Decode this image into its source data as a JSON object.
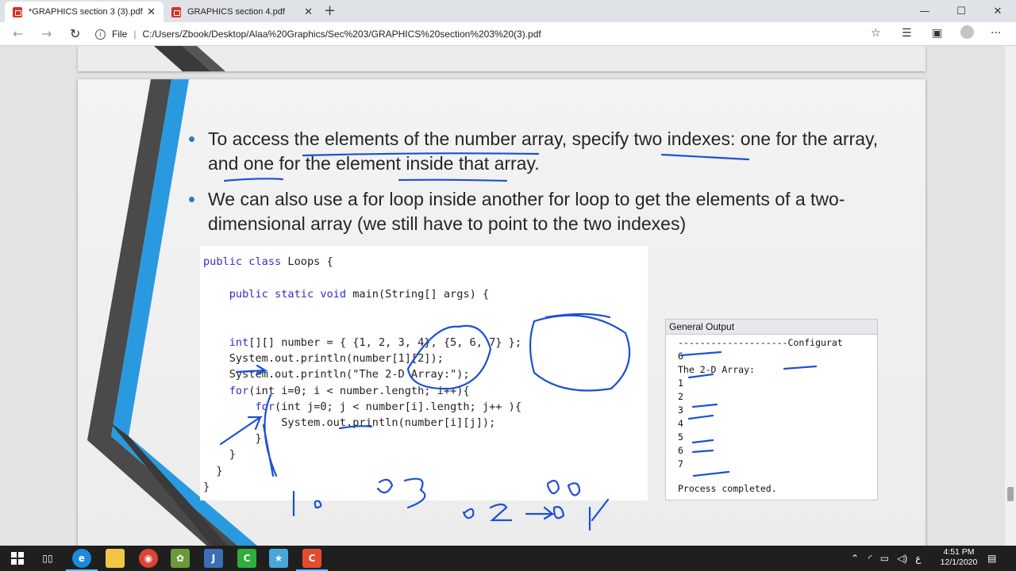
{
  "browser": {
    "tabs": [
      {
        "label": "*GRAPHICS section 3 (3).pdf",
        "active": true
      },
      {
        "label": "GRAPHICS section 4.pdf",
        "active": false
      }
    ],
    "tab_close": "✕",
    "new_tab": "+",
    "window_buttons": [
      "—",
      "☐",
      "✕"
    ],
    "address": {
      "scheme_label": "File",
      "url": "C:/Users/Zbook/Desktop/Alaa%20Graphics/Sec%203/GRAPHICS%20section%203%20(3).pdf"
    },
    "nav": {
      "back": "←",
      "forward": "→",
      "refresh": "↻"
    },
    "toolbar_icons": [
      "star-icon",
      "favorites-icon",
      "collections-icon",
      "profile-icon",
      "more-icon"
    ],
    "more": "···"
  },
  "slide": {
    "bullets": [
      "To access the elements of the number array, specify two indexes: one for the array, and one for the element inside that array.",
      "We can also use a for loop inside another for loop to get the elements of a two-dimensional array (we still have to point to the two indexes)"
    ],
    "code": [
      {
        "kw": "public class ",
        "rest": "Loops {"
      },
      {
        "kw": "    public static void ",
        "rest": "main(String[] args) {"
      },
      {
        "kw": "    int",
        "rest": "[][] number = { {1, 2, 3, 4}, {5, 6, 7} };"
      },
      {
        "kw": "",
        "rest": "    System.out.println(number[1][2]);"
      },
      {
        "kw": "",
        "rest": "    System.out.println(\"The 2-D Array:\");"
      },
      {
        "kw": "    for",
        "rest": "(int i=0; i < number.length; i++){"
      },
      {
        "kw": "        for",
        "rest": "(int j=0; j < number[i].length; j++ ){"
      },
      {
        "kw": "",
        "rest": "            System.out.println(number[i][j]);"
      },
      {
        "kw": "",
        "rest": "        }"
      },
      {
        "kw": "",
        "rest": "    }"
      },
      {
        "kw": "",
        "rest": "  }"
      },
      {
        "kw": "",
        "rest": "}"
      }
    ],
    "output": {
      "title": "General Output",
      "lines": [
        "--------------------Configurat",
        "6",
        "The 2-D Array:",
        "1",
        "2",
        "3",
        "4",
        "5",
        "6",
        "7",
        "",
        "Process completed."
      ]
    }
  },
  "taskbar": {
    "apps": [
      "start-icon",
      "task-view-icon",
      "edge-icon",
      "file-explorer-icon",
      "chrome-icon",
      "paint-icon",
      "jcreator-icon",
      "camtasia-icon",
      "app-icon",
      "recorder-icon"
    ],
    "tray_lang": "ع",
    "time": "4:51 PM",
    "date": "12/1/2020"
  },
  "colors": {
    "accent_blue": "#2a7dc1",
    "ink": "#1d4fd6",
    "code_keyword": "#3030c8"
  }
}
